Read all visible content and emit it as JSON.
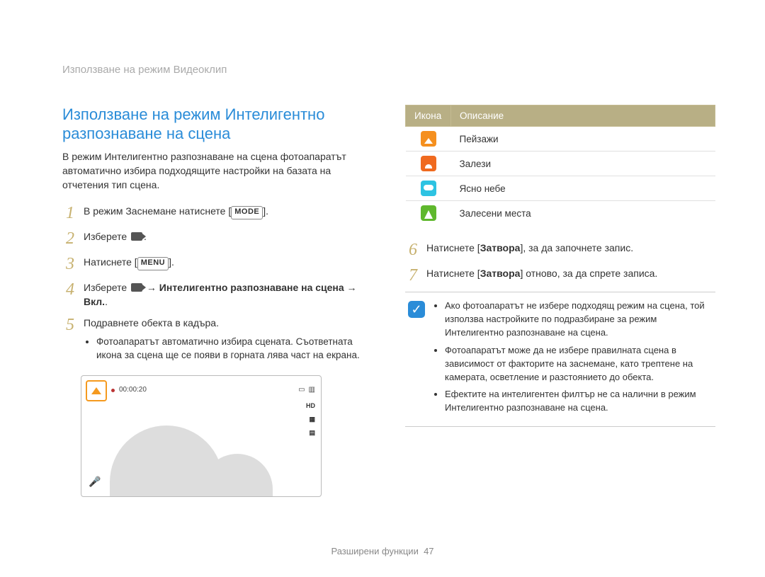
{
  "header": {
    "title": "Използване на режим Видеоклип"
  },
  "left": {
    "section_title": "Използване на режим Интелигентно разпознаване на сцена",
    "intro": "В режим Интелигентно разпознаване на сцена фотоапаратът автоматично избира подходящите настройки на базата на отчетения тип сцена.",
    "steps": {
      "s1_prefix": "В режим Заснемане натиснете [",
      "s1_btn": "MODE",
      "s1_suffix": "].",
      "s2_prefix": "Изберете ",
      "s2_suffix": ".",
      "s3_prefix": "Натиснете [",
      "s3_btn": "MENU",
      "s3_suffix": "].",
      "s4_prefix": "Изберете ",
      "s4_mid": " → ",
      "s4_bold": "Интелигентно разпознаване на сцена",
      "s4_mid2": " → ",
      "s4_bold2": "Вкл.",
      "s4_suffix": ".",
      "s5": "Подравнете обекта в кадъра.",
      "s5_sub": "Фотоапаратът автоматично избира сцената. Съответната икона за сцена ще се появи в горната лява част на екрана."
    },
    "lcd": {
      "time": "00:00:20",
      "hd": "HD"
    }
  },
  "right": {
    "table": {
      "th_icon": "Икона",
      "th_desc": "Описание",
      "rows": [
        {
          "icon_class": "orange",
          "shape": "tri",
          "desc": "Пейзажи"
        },
        {
          "icon_class": "orange2",
          "shape": "sun",
          "desc": "Залези"
        },
        {
          "icon_class": "cyan",
          "shape": "cloud",
          "desc": "Ясно небе"
        },
        {
          "icon_class": "green",
          "shape": "tree",
          "desc": "Залесени места"
        }
      ]
    },
    "steps": {
      "s6_prefix": "Натиснете [",
      "s6_bold": "Затвора",
      "s6_suffix": "], за да започнете запис.",
      "s7_prefix": "Натиснете [",
      "s7_bold": "Затвора",
      "s7_suffix": "] отново, за да спрете записа."
    },
    "notes": [
      "Ако фотоапаратът не избере подходящ режим на сцена, той използва настройките по подразбиране за режим Интелигентно разпознаване на сцена.",
      "Фотоапаратът може да не избере правилната сцена в зависимост от факторите на заснемане, като трептене на камерата, осветление и разстоянието до обекта.",
      "Ефектите на интелигентен филтър не са налични в режим Интелигентно разпознаване на сцена."
    ]
  },
  "footer": {
    "section": "Разширени функции",
    "page": "47"
  }
}
